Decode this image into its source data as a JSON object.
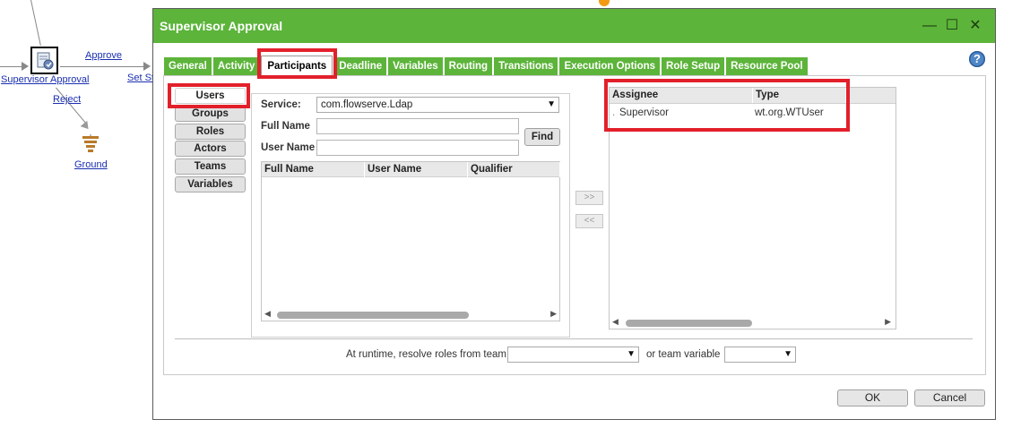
{
  "workflow": {
    "node_label": "Supervisor Approval",
    "approve_label": "Approve",
    "set_label": "Set St",
    "reject_label": "Reject",
    "ground_label": "Ground"
  },
  "dialog": {
    "title": "Supervisor Approval",
    "tabs": [
      {
        "label": "General"
      },
      {
        "label": "Activity"
      },
      {
        "label": "Participants"
      },
      {
        "label": "Deadline"
      },
      {
        "label": "Variables"
      },
      {
        "label": "Routing"
      },
      {
        "label": "Transitions"
      },
      {
        "label": "Execution Options"
      },
      {
        "label": "Role Setup"
      },
      {
        "label": "Resource Pool"
      }
    ],
    "active_tab": "Participants",
    "participant_types": [
      {
        "label": "Users"
      },
      {
        "label": "Groups"
      },
      {
        "label": "Roles"
      },
      {
        "label": "Actors"
      },
      {
        "label": "Teams"
      },
      {
        "label": "Variables"
      }
    ],
    "selected_type": "Users",
    "search": {
      "service_label": "Service:",
      "service_value": "com.flowserve.Ldap",
      "fullname_label": "Full Name",
      "fullname_value": "",
      "username_label": "User Name",
      "username_value": "",
      "find_label": "Find",
      "columns": [
        "Full Name",
        "User Name",
        "Qualifier"
      ]
    },
    "move_right_label": ">>",
    "move_left_label": "<<",
    "assignees": {
      "columns": [
        "Assignee",
        "Type"
      ],
      "rows": [
        {
          "assignee": "Supervisor",
          "type": "wt.org.WTUser"
        }
      ]
    },
    "runtime_label": "At runtime, resolve roles from team",
    "runtime_value": "",
    "team_variable_label": "or team variable",
    "team_variable_value": "",
    "ok_label": "OK",
    "cancel_label": "Cancel"
  },
  "colors": {
    "accent_green": "#5cb43a",
    "highlight_red": "#e2202b",
    "link_blue": "#1a2fb0"
  },
  "icons": [
    "minimize-icon",
    "maximize-icon",
    "close-icon",
    "help-icon",
    "activity-node-icon",
    "ground-icon"
  ]
}
